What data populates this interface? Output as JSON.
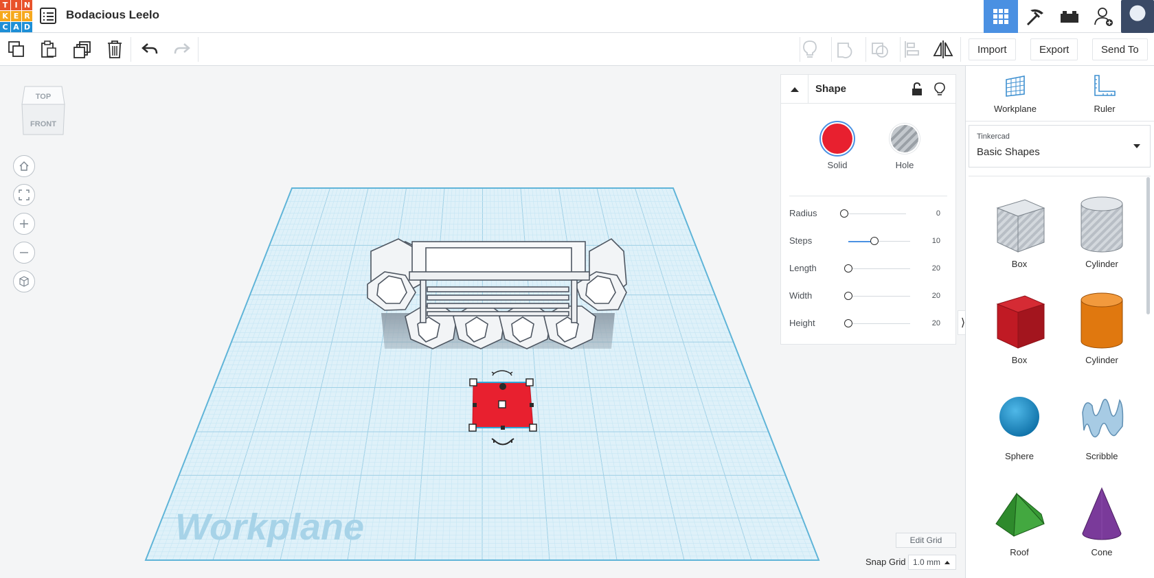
{
  "app": {
    "logo_letters": [
      "T",
      "I",
      "N",
      "K",
      "E",
      "R",
      "C",
      "A",
      "D"
    ],
    "logo_colors": [
      "#e8522b",
      "#e8522b",
      "#e8522b",
      "#f6a81d",
      "#f6a81d",
      "#f6a81d",
      "#1e8fd6",
      "#1e8fd6",
      "#1e8fd6"
    ],
    "project_title": "Bodacious Leelo"
  },
  "topbar": {
    "buttons": [
      {
        "name": "3d-design-view-icon",
        "active": true
      },
      {
        "name": "pickaxe-icon",
        "active": false
      },
      {
        "name": "brick-icon",
        "active": false
      },
      {
        "name": "add-user-icon",
        "active": false
      }
    ]
  },
  "toolbar": {
    "import_label": "Import",
    "export_label": "Export",
    "send_to_label": "Send To"
  },
  "viewcube": {
    "top_label": "TOP",
    "front_label": "FRONT"
  },
  "workplane": {
    "watermark": "Workplane",
    "grid_color": "#c6e6f4",
    "edge_color": "#5fb4d8"
  },
  "inspector": {
    "title": "Shape",
    "solid_label": "Solid",
    "hole_label": "Hole",
    "solid_color": "#e8202f",
    "params": [
      {
        "label": "Radius",
        "value": "0",
        "fraction": 0.0
      },
      {
        "label": "Steps",
        "value": "10",
        "fraction": 0.47
      },
      {
        "label": "Length",
        "value": "20",
        "fraction": 0.0
      },
      {
        "label": "Width",
        "value": "20",
        "fraction": 0.0
      },
      {
        "label": "Height",
        "value": "20",
        "fraction": 0.0
      }
    ]
  },
  "bottom": {
    "edit_grid_label": "Edit Grid",
    "snap_grid_label": "Snap Grid",
    "snap_grid_value": "1.0 mm"
  },
  "right_panel": {
    "workplane_label": "Workplane",
    "ruler_label": "Ruler",
    "library_sub": "Tinkercad",
    "library_main": "Basic Shapes",
    "shapes": [
      {
        "label": "Box",
        "icon": "box-hole-icon"
      },
      {
        "label": "Cylinder",
        "icon": "cylinder-hole-icon"
      },
      {
        "label": "Box",
        "icon": "box-red-icon"
      },
      {
        "label": "Cylinder",
        "icon": "cylinder-orange-icon"
      },
      {
        "label": "Sphere",
        "icon": "sphere-icon"
      },
      {
        "label": "Scribble",
        "icon": "scribble-icon"
      },
      {
        "label": "Roof",
        "icon": "roof-icon"
      },
      {
        "label": "Cone",
        "icon": "cone-icon"
      }
    ]
  }
}
